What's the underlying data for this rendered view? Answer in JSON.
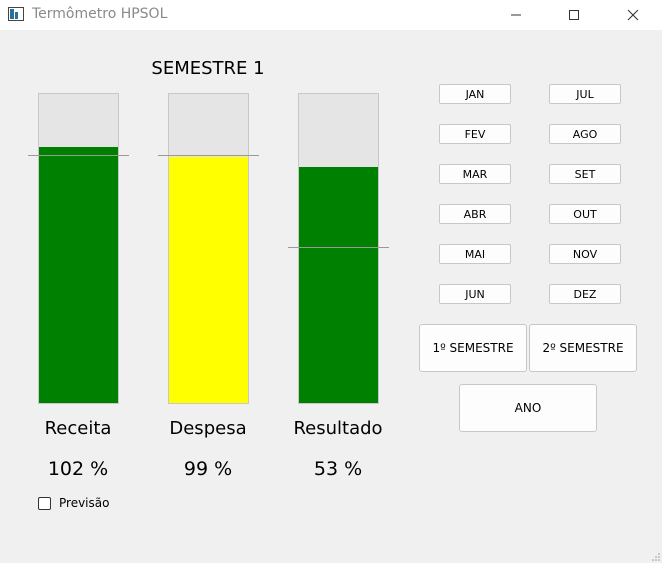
{
  "window": {
    "title": "Termômetro HPSOL",
    "icons": {
      "app": "thermometer-app-icon",
      "minimize": "minimize-icon",
      "maximize": "maximize-icon",
      "close": "close-icon"
    }
  },
  "main": {
    "semester_title": "SEMESTRE 1",
    "bars": [
      {
        "label": "Receita",
        "percent_text": "102 %",
        "fill_fraction": 0.83,
        "target_fraction": 0.8,
        "fill_color": "#008000"
      },
      {
        "label": "Despesa",
        "percent_text": "99 %",
        "fill_fraction": 0.795,
        "target_fraction": 0.8,
        "fill_color": "#ffff00"
      },
      {
        "label": "Resultado",
        "percent_text": "53 %",
        "fill_fraction": 0.765,
        "target_fraction": 0.505,
        "fill_color": "#008000"
      }
    ],
    "checkbox": {
      "label": "Previsão",
      "checked": false
    }
  },
  "months": {
    "left": [
      "JAN",
      "FEV",
      "MAR",
      "ABR",
      "MAI",
      "JUN"
    ],
    "right": [
      "JUL",
      "AGO",
      "SET",
      "OUT",
      "NOV",
      "DEZ"
    ]
  },
  "periods": {
    "semester1": "1º SEMESTRE",
    "semester2": "2º SEMESTRE",
    "year": "ANO"
  },
  "colors": {
    "track": "#e5e5e5",
    "marker": "#9a9a9a",
    "background": "#f0f0f0"
  }
}
